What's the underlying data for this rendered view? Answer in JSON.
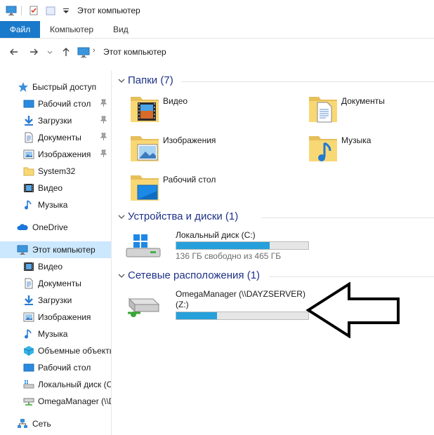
{
  "window": {
    "title": "Этот компьютер"
  },
  "ribbon": {
    "tabs": [
      {
        "label": "Файл",
        "active": true
      },
      {
        "label": "Компьютер"
      },
      {
        "label": "Вид"
      }
    ]
  },
  "address": {
    "breadcrumb": "Этот компьютер"
  },
  "sidebar": {
    "items": [
      {
        "label": "Быстрый доступ",
        "icon": "star-icon"
      },
      {
        "label": "Рабочий стол",
        "icon": "desktop-icon",
        "pinned": true
      },
      {
        "label": "Загрузки",
        "icon": "downloads-icon",
        "pinned": true
      },
      {
        "label": "Документы",
        "icon": "documents-icon",
        "pinned": true
      },
      {
        "label": "Изображения",
        "icon": "pictures-icon",
        "pinned": true
      },
      {
        "label": "System32",
        "icon": "folder-icon"
      },
      {
        "label": "Видео",
        "icon": "videos-icon"
      },
      {
        "label": "Музыка",
        "icon": "music-icon"
      },
      {
        "label": "OneDrive",
        "icon": "onedrive-icon"
      },
      {
        "label": "Этот компьютер",
        "icon": "computer-icon",
        "selected": true
      },
      {
        "label": "Видео",
        "icon": "videos-icon"
      },
      {
        "label": "Документы",
        "icon": "documents-icon"
      },
      {
        "label": "Загрузки",
        "icon": "downloads-icon"
      },
      {
        "label": "Изображения",
        "icon": "pictures-icon"
      },
      {
        "label": "Музыка",
        "icon": "music-icon"
      },
      {
        "label": "Объемные объекты",
        "icon": "3d-objects-icon"
      },
      {
        "label": "Рабочий стол",
        "icon": "desktop-icon"
      },
      {
        "label": "Локальный диск (C:)",
        "icon": "local-disk-icon"
      },
      {
        "label": "OmegaManager (\\\\DAYZSERVER) (Z:)",
        "icon": "network-drive-icon"
      },
      {
        "label": "Сеть",
        "icon": "network-icon"
      }
    ]
  },
  "groups": {
    "folders": {
      "title": "Папки (7)",
      "items": [
        {
          "name": "Видео",
          "icon": "videos-folder-icon"
        },
        {
          "name": "Документы",
          "icon": "documents-folder-icon"
        },
        {
          "name": "Изображения",
          "icon": "pictures-folder-icon"
        },
        {
          "name": "Музыка",
          "icon": "music-folder-icon"
        },
        {
          "name": "Рабочий стол",
          "icon": "desktop-folder-icon"
        }
      ]
    },
    "devices": {
      "title": "Устройства и диски (1)",
      "items": [
        {
          "name": "Локальный диск (C:)",
          "info": "136 ГБ свободно из 465 ГБ",
          "used_fraction": 0.71,
          "icon": "windows-drive-icon"
        }
      ]
    },
    "network": {
      "title": "Сетевые расположения (1)",
      "items": [
        {
          "name_line1": "OmegaManager (\\\\DAYZSERVER)",
          "name_line2": "(Z:)",
          "used_fraction": 0.31,
          "icon": "network-drive-icon"
        }
      ]
    }
  },
  "colors": {
    "accent": "#1979ca",
    "selection": "#cce8ff",
    "group_title": "#1e3287",
    "bar_fill": "#26a0da",
    "folder": "#f8d775"
  },
  "annotation": {
    "icon": "left-arrow-icon"
  }
}
